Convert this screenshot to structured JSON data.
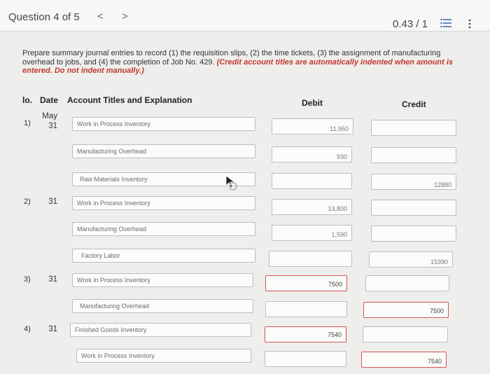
{
  "header": {
    "question": "Question 4 of 5",
    "prev": "<",
    "next": ">",
    "score": "0.43 / 1"
  },
  "prompt": {
    "text": "Prepare summary journal entries to record (1) the requisition slips, (2) the time tickets, (3) the assignment of manufacturing overhead to jobs, and (4) the completion of Job No. 429. ",
    "emphasis": "(Credit account titles are automatically indented when amount is entered. Do not indent manually.)"
  },
  "table": {
    "col_no": "lo.",
    "col_date": "Date",
    "col_account": "Account Titles and Explanation",
    "col_debit": "Debit",
    "col_credit": "Credit"
  },
  "entries": [
    {
      "no": "1)",
      "month": "May",
      "day": "31",
      "lines": [
        {
          "account": "Work in Process Inventory",
          "debit": "11,950",
          "credit": ""
        },
        {
          "account": "Manufacturing Overhead",
          "debit": "930",
          "credit": ""
        },
        {
          "account": "Raw Materials Inventory",
          "debit": "",
          "credit": "12880"
        }
      ]
    },
    {
      "no": "2)",
      "month": "",
      "day": "31",
      "lines": [
        {
          "account": "Work in Process Inventory",
          "debit": "13,800",
          "credit": ""
        },
        {
          "account": "Manufacturing Overhead",
          "debit": "1,590",
          "credit": ""
        },
        {
          "account": "Factory Labor",
          "debit": "",
          "credit": "15390"
        }
      ]
    },
    {
      "no": "3)",
      "month": "",
      "day": "31",
      "lines": [
        {
          "account": "Work in Process Inventory",
          "debit": "7500",
          "credit": ""
        },
        {
          "account": "Manufacturing Overhead",
          "debit": "",
          "credit": "7500"
        }
      ]
    },
    {
      "no": "4)",
      "month": "",
      "day": "31",
      "lines": [
        {
          "account": "Finished Goods Inventory",
          "debit": "7540",
          "credit": ""
        },
        {
          "account": "Work in Process Inventory",
          "debit": "",
          "credit": "7540"
        }
      ]
    }
  ],
  "colors": {
    "error_border": "#d9534f"
  }
}
